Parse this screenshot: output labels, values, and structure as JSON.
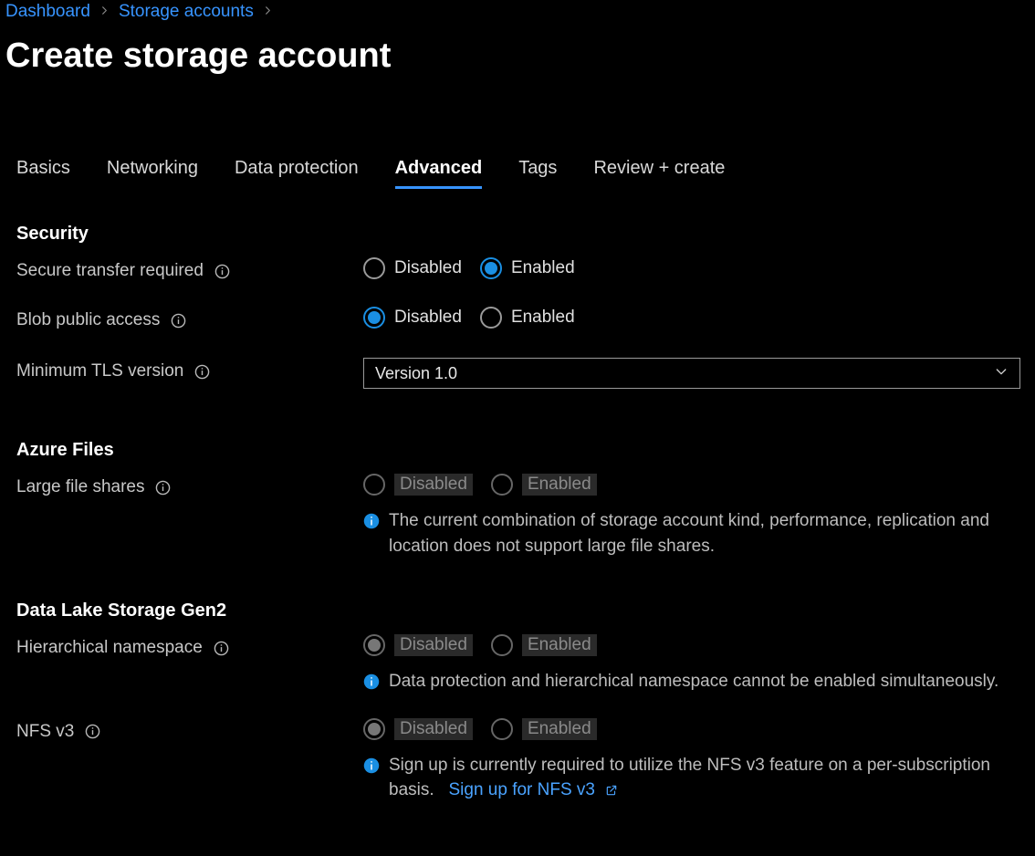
{
  "breadcrumb": {
    "items": [
      "Dashboard",
      "Storage accounts"
    ]
  },
  "page_title": "Create storage account",
  "tabs": [
    {
      "label": "Basics",
      "active": false
    },
    {
      "label": "Networking",
      "active": false
    },
    {
      "label": "Data protection",
      "active": false
    },
    {
      "label": "Advanced",
      "active": true
    },
    {
      "label": "Tags",
      "active": false
    },
    {
      "label": "Review + create",
      "active": false
    }
  ],
  "radio_labels": {
    "disabled": "Disabled",
    "enabled": "Enabled"
  },
  "sections": {
    "security": {
      "heading": "Security",
      "secure_transfer": {
        "label": "Secure transfer required"
      },
      "blob_public": {
        "label": "Blob public access"
      },
      "min_tls": {
        "label": "Minimum TLS version",
        "value": "Version 1.0"
      }
    },
    "azure_files": {
      "heading": "Azure Files",
      "large_file_shares": {
        "label": "Large file shares",
        "note": "The current combination of storage account kind, performance, replication and location does not support large file shares."
      }
    },
    "dls": {
      "heading": "Data Lake Storage Gen2",
      "hns": {
        "label": "Hierarchical namespace",
        "note": "Data protection and hierarchical namespace cannot be enabled simultaneously."
      },
      "nfs": {
        "label": "NFS v3",
        "note": "Sign up is currently required to utilize the NFS v3 feature on a per-subscription basis.",
        "link": "Sign up for NFS v3"
      }
    }
  }
}
